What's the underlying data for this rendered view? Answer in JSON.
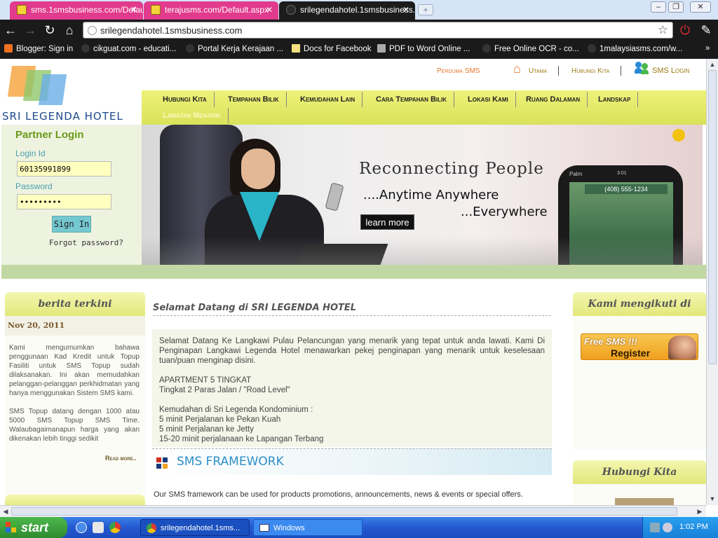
{
  "browser": {
    "tabs": [
      {
        "label": "sms.1smsbusiness.com/Defaul"
      },
      {
        "label": "terajusms.com/Default.aspx"
      },
      {
        "label": "srilegendahotel.1smsbusiness."
      }
    ],
    "url": "srilegendahotel.1smsbusiness.com",
    "bookmarks": [
      "Blogger: Sign in",
      "cikguat.com - educati...",
      "Portal Kerja Kerajaan ...",
      "Docs for Facebook",
      "PDF to Word Online ...",
      "Free Online OCR - co...",
      "1malaysiasms.com/w..."
    ]
  },
  "site": {
    "logo_text": "SRI LEGENDA HOTEL",
    "top_links": {
      "perduma": "Perduma SMS",
      "home": "Utama",
      "contact": "Hubungi Kita",
      "sms_login": "SMS Login"
    },
    "nav": [
      "Hubungi Kita",
      "Tempahan Bilik",
      "Kemudahan Lain",
      "Cara Tempahan Bilik",
      "Lokasi Kami",
      "Ruang Dalaman",
      "Landskap",
      "Lawatan Menarik"
    ],
    "login": {
      "title": "Partner Login",
      "id_label": "Login Id",
      "id_value": "60135991899",
      "password_label": "Password",
      "password_value": "•••••••••",
      "signin": "Sign In",
      "forgot": "Forgot password?"
    },
    "banner": {
      "headline": "Reconnecting People",
      "line1": "....Anytime Anywhere",
      "line2": "...Everywhere",
      "button": "learn more",
      "phone_number": "(408) 555-1234",
      "phone_brand": "Palm",
      "phone_time": "3:01"
    },
    "news": {
      "title": "berita terkini",
      "date": "Nov 20, 2011",
      "p1": "Kami mengumumkan bahawa penggunaan Kad Kredit untuk Topup Fasiliti untuk SMS Topup sudah dilaksanakan. Ini akan memudahkan pelanggan-pelanggan perkhidmatan yang hanya menggunakan Sistem SMS kami.",
      "p2": "SMS Topup datang dengan 1000 atau 5000 SMS Topup SMS Time. Walaubagaimanapun harga yang akan dikenakan lebih tinggi sedikit",
      "read_more": "Read more.."
    },
    "welcome": {
      "title": "Selamat Datang di SRI LEGENDA HOTEL",
      "p1": "Selamat Datang Ke Langkawi Pulau Pelancungan yang menarik yang tepat untuk anda lawati. Kami Di Penginapan Langkawi Legenda Hotel menawarkan pekej penginapan yang menarik untuk keselesaan tuan/puan menginap disini.",
      "apt1": "APARTMENT 5 TINGKAT",
      "apt2": "Tingkat 2 Paras Jalan / \"Road Level\"",
      "fac_title": "Kemudahan di Sri Legenda Kondominium :",
      "fac1": "5 minit Perjalanan ke Pekan Kuah",
      "fac2": "5 minit Perjalanan ke Jetty",
      "fac3": "15-20 minit perjalanaan ke Lapangan Terbang"
    },
    "framework": {
      "title": "SMS FRAMEWORK",
      "text": "Our SMS framework can be used for products promotions, announcements, news & events or special offers."
    },
    "right": {
      "follow_title": "Kami mengikuti di",
      "freesms_a": "Free SMS !!!",
      "freesms_b": "Register",
      "contact_title": "Hubungi Kita"
    }
  },
  "taskbar": {
    "start": "start",
    "items": [
      "srilegendahotel.1sms...",
      "Windows"
    ],
    "clock": "1:02 PM"
  },
  "colors": {
    "nav_yellow": "#e2e87a",
    "tab_pink": "#e23a8c",
    "link_orange": "#e8722a",
    "accent_blue": "#2b8fc7"
  }
}
